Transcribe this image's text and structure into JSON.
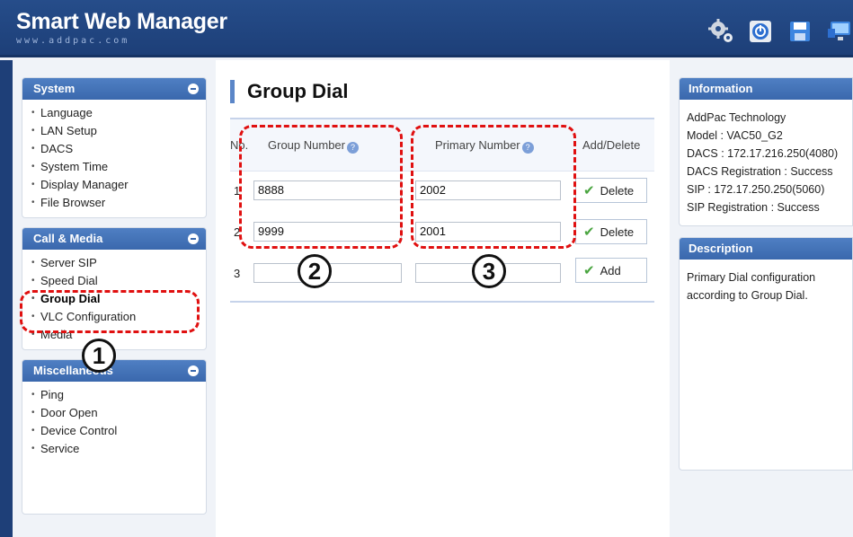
{
  "header": {
    "title": "Smart Web Manager",
    "subtitle": "www.addpac.com",
    "icons": [
      "gear-icon",
      "power-icon",
      "save-icon",
      "monitor-icon"
    ]
  },
  "sidebar": {
    "system": {
      "title": "System",
      "items": [
        "Language",
        "LAN Setup",
        "DACS",
        "System Time",
        "Display Manager",
        "File Browser"
      ]
    },
    "call_media": {
      "title": "Call & Media",
      "items": [
        "Server SIP",
        "Speed Dial",
        "Group Dial",
        "VLC Configuration",
        "Media"
      ]
    },
    "misc": {
      "title": "Miscellaneous",
      "items": [
        "Ping",
        "Door Open",
        "Device Control",
        "Service"
      ]
    }
  },
  "main": {
    "title": "Group Dial",
    "columns": {
      "no": "No.",
      "group": "Group Number",
      "primary": "Primary Number",
      "action": "Add/Delete"
    },
    "rows": [
      {
        "no": "1",
        "group": "8888",
        "primary": "2002",
        "action": "Delete"
      },
      {
        "no": "2",
        "group": "9999",
        "primary": "2001",
        "action": "Delete"
      },
      {
        "no": "3",
        "group": "",
        "primary": "",
        "action": "Add"
      }
    ]
  },
  "info": {
    "title": "Information",
    "lines": [
      "AddPac Technology",
      "Model : VAC50_G2",
      "DACS : 172.17.216.250(4080)",
      "DACS Registration : Success",
      "SIP : 172.17.250.250(5060)",
      "SIP Registration : Success"
    ]
  },
  "description": {
    "title": "Description",
    "text": "Primary Dial configuration according to Group Dial."
  },
  "annotations": [
    "1",
    "2",
    "3"
  ],
  "colors": {
    "header": "#264d8a",
    "panel_head": "#3a68ad",
    "annotation": "#e01010",
    "check": "#4aa540"
  }
}
